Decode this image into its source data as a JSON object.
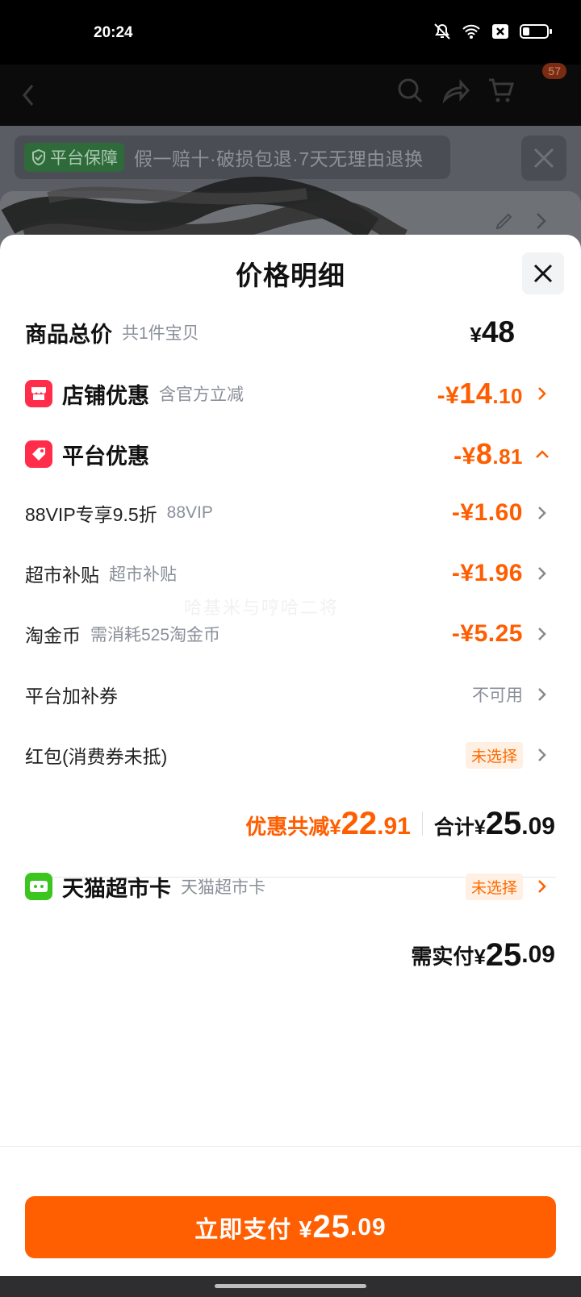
{
  "status_bar": {
    "time": "20:24",
    "battery_level": 0.3
  },
  "background": {
    "cart_badge": "57",
    "guarantee_tag": "平台保障",
    "guarantee_text": "假一赔十·破损包退·7天无理由退换"
  },
  "sheet": {
    "title": "价格明细",
    "total": {
      "label": "商品总价",
      "sub": "共1件宝贝",
      "yen": "¥",
      "value": "48"
    },
    "store_discount": {
      "label": "店铺优惠",
      "sub": "含官方立减",
      "prefix": "-¥",
      "int": "14",
      "dec": ".10"
    },
    "platform_discount": {
      "label": "平台优惠",
      "prefix": "-¥",
      "int": "8",
      "dec": ".81"
    },
    "items": [
      {
        "label": "88VIP专享9.5折",
        "sub": "88VIP",
        "value": "-¥1.60"
      },
      {
        "label": "超市补贴",
        "sub": "超市补贴",
        "value": "-¥1.96"
      },
      {
        "label": "淘金币",
        "sub": "需消耗525淘金币",
        "value": "-¥5.25"
      }
    ],
    "platform_coupon": {
      "label": "平台加补券",
      "value": "不可用"
    },
    "red_packet": {
      "label": "红包(消费券未抵)",
      "value": "未选择"
    },
    "summary": {
      "discount_label": "优惠共减¥",
      "discount_int": "22",
      "discount_dec": ".91",
      "total_label": "合计¥",
      "total_int": "25",
      "total_dec": ".09"
    },
    "tmall_card": {
      "label": "天猫超市卡",
      "sub": "天猫超市卡",
      "value": "未选择"
    },
    "actual_pay": {
      "label": "需实付¥",
      "int": "25",
      "dec": ".09"
    },
    "watermark": "哈基米与哼哈二将",
    "pay_button": {
      "label": "立即支付 ¥",
      "int": "25",
      "dec": ".09"
    }
  },
  "colors": {
    "accent": "#ff5f00",
    "discount_text": "#ff5e00",
    "store_icon": "#ff2d4a",
    "tmall_icon": "#3cc51f"
  }
}
